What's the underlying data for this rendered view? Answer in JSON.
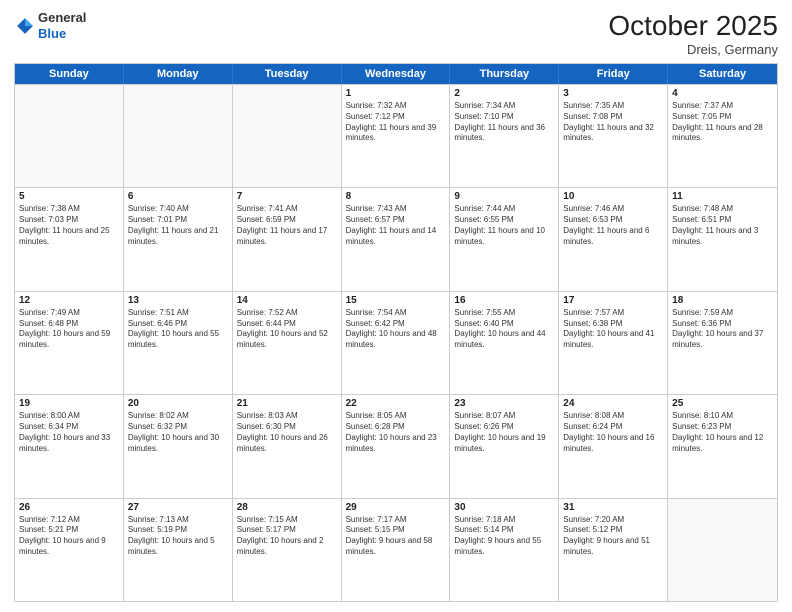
{
  "header": {
    "logo_general": "General",
    "logo_blue": "Blue",
    "month_title": "October 2025",
    "location": "Dreis, Germany"
  },
  "weekdays": [
    "Sunday",
    "Monday",
    "Tuesday",
    "Wednesday",
    "Thursday",
    "Friday",
    "Saturday"
  ],
  "rows": [
    [
      {
        "day": "",
        "sunrise": "",
        "sunset": "",
        "daylight": ""
      },
      {
        "day": "",
        "sunrise": "",
        "sunset": "",
        "daylight": ""
      },
      {
        "day": "",
        "sunrise": "",
        "sunset": "",
        "daylight": ""
      },
      {
        "day": "1",
        "sunrise": "Sunrise: 7:32 AM",
        "sunset": "Sunset: 7:12 PM",
        "daylight": "Daylight: 11 hours and 39 minutes."
      },
      {
        "day": "2",
        "sunrise": "Sunrise: 7:34 AM",
        "sunset": "Sunset: 7:10 PM",
        "daylight": "Daylight: 11 hours and 36 minutes."
      },
      {
        "day": "3",
        "sunrise": "Sunrise: 7:35 AM",
        "sunset": "Sunset: 7:08 PM",
        "daylight": "Daylight: 11 hours and 32 minutes."
      },
      {
        "day": "4",
        "sunrise": "Sunrise: 7:37 AM",
        "sunset": "Sunset: 7:05 PM",
        "daylight": "Daylight: 11 hours and 28 minutes."
      }
    ],
    [
      {
        "day": "5",
        "sunrise": "Sunrise: 7:38 AM",
        "sunset": "Sunset: 7:03 PM",
        "daylight": "Daylight: 11 hours and 25 minutes."
      },
      {
        "day": "6",
        "sunrise": "Sunrise: 7:40 AM",
        "sunset": "Sunset: 7:01 PM",
        "daylight": "Daylight: 11 hours and 21 minutes."
      },
      {
        "day": "7",
        "sunrise": "Sunrise: 7:41 AM",
        "sunset": "Sunset: 6:59 PM",
        "daylight": "Daylight: 11 hours and 17 minutes."
      },
      {
        "day": "8",
        "sunrise": "Sunrise: 7:43 AM",
        "sunset": "Sunset: 6:57 PM",
        "daylight": "Daylight: 11 hours and 14 minutes."
      },
      {
        "day": "9",
        "sunrise": "Sunrise: 7:44 AM",
        "sunset": "Sunset: 6:55 PM",
        "daylight": "Daylight: 11 hours and 10 minutes."
      },
      {
        "day": "10",
        "sunrise": "Sunrise: 7:46 AM",
        "sunset": "Sunset: 6:53 PM",
        "daylight": "Daylight: 11 hours and 6 minutes."
      },
      {
        "day": "11",
        "sunrise": "Sunrise: 7:48 AM",
        "sunset": "Sunset: 6:51 PM",
        "daylight": "Daylight: 11 hours and 3 minutes."
      }
    ],
    [
      {
        "day": "12",
        "sunrise": "Sunrise: 7:49 AM",
        "sunset": "Sunset: 6:48 PM",
        "daylight": "Daylight: 10 hours and 59 minutes."
      },
      {
        "day": "13",
        "sunrise": "Sunrise: 7:51 AM",
        "sunset": "Sunset: 6:46 PM",
        "daylight": "Daylight: 10 hours and 55 minutes."
      },
      {
        "day": "14",
        "sunrise": "Sunrise: 7:52 AM",
        "sunset": "Sunset: 6:44 PM",
        "daylight": "Daylight: 10 hours and 52 minutes."
      },
      {
        "day": "15",
        "sunrise": "Sunrise: 7:54 AM",
        "sunset": "Sunset: 6:42 PM",
        "daylight": "Daylight: 10 hours and 48 minutes."
      },
      {
        "day": "16",
        "sunrise": "Sunrise: 7:55 AM",
        "sunset": "Sunset: 6:40 PM",
        "daylight": "Daylight: 10 hours and 44 minutes."
      },
      {
        "day": "17",
        "sunrise": "Sunrise: 7:57 AM",
        "sunset": "Sunset: 6:38 PM",
        "daylight": "Daylight: 10 hours and 41 minutes."
      },
      {
        "day": "18",
        "sunrise": "Sunrise: 7:59 AM",
        "sunset": "Sunset: 6:36 PM",
        "daylight": "Daylight: 10 hours and 37 minutes."
      }
    ],
    [
      {
        "day": "19",
        "sunrise": "Sunrise: 8:00 AM",
        "sunset": "Sunset: 6:34 PM",
        "daylight": "Daylight: 10 hours and 33 minutes."
      },
      {
        "day": "20",
        "sunrise": "Sunrise: 8:02 AM",
        "sunset": "Sunset: 6:32 PM",
        "daylight": "Daylight: 10 hours and 30 minutes."
      },
      {
        "day": "21",
        "sunrise": "Sunrise: 8:03 AM",
        "sunset": "Sunset: 6:30 PM",
        "daylight": "Daylight: 10 hours and 26 minutes."
      },
      {
        "day": "22",
        "sunrise": "Sunrise: 8:05 AM",
        "sunset": "Sunset: 6:28 PM",
        "daylight": "Daylight: 10 hours and 23 minutes."
      },
      {
        "day": "23",
        "sunrise": "Sunrise: 8:07 AM",
        "sunset": "Sunset: 6:26 PM",
        "daylight": "Daylight: 10 hours and 19 minutes."
      },
      {
        "day": "24",
        "sunrise": "Sunrise: 8:08 AM",
        "sunset": "Sunset: 6:24 PM",
        "daylight": "Daylight: 10 hours and 16 minutes."
      },
      {
        "day": "25",
        "sunrise": "Sunrise: 8:10 AM",
        "sunset": "Sunset: 6:23 PM",
        "daylight": "Daylight: 10 hours and 12 minutes."
      }
    ],
    [
      {
        "day": "26",
        "sunrise": "Sunrise: 7:12 AM",
        "sunset": "Sunset: 5:21 PM",
        "daylight": "Daylight: 10 hours and 9 minutes."
      },
      {
        "day": "27",
        "sunrise": "Sunrise: 7:13 AM",
        "sunset": "Sunset: 5:19 PM",
        "daylight": "Daylight: 10 hours and 5 minutes."
      },
      {
        "day": "28",
        "sunrise": "Sunrise: 7:15 AM",
        "sunset": "Sunset: 5:17 PM",
        "daylight": "Daylight: 10 hours and 2 minutes."
      },
      {
        "day": "29",
        "sunrise": "Sunrise: 7:17 AM",
        "sunset": "Sunset: 5:15 PM",
        "daylight": "Daylight: 9 hours and 58 minutes."
      },
      {
        "day": "30",
        "sunrise": "Sunrise: 7:18 AM",
        "sunset": "Sunset: 5:14 PM",
        "daylight": "Daylight: 9 hours and 55 minutes."
      },
      {
        "day": "31",
        "sunrise": "Sunrise: 7:20 AM",
        "sunset": "Sunset: 5:12 PM",
        "daylight": "Daylight: 9 hours and 51 minutes."
      },
      {
        "day": "",
        "sunrise": "",
        "sunset": "",
        "daylight": ""
      }
    ]
  ]
}
